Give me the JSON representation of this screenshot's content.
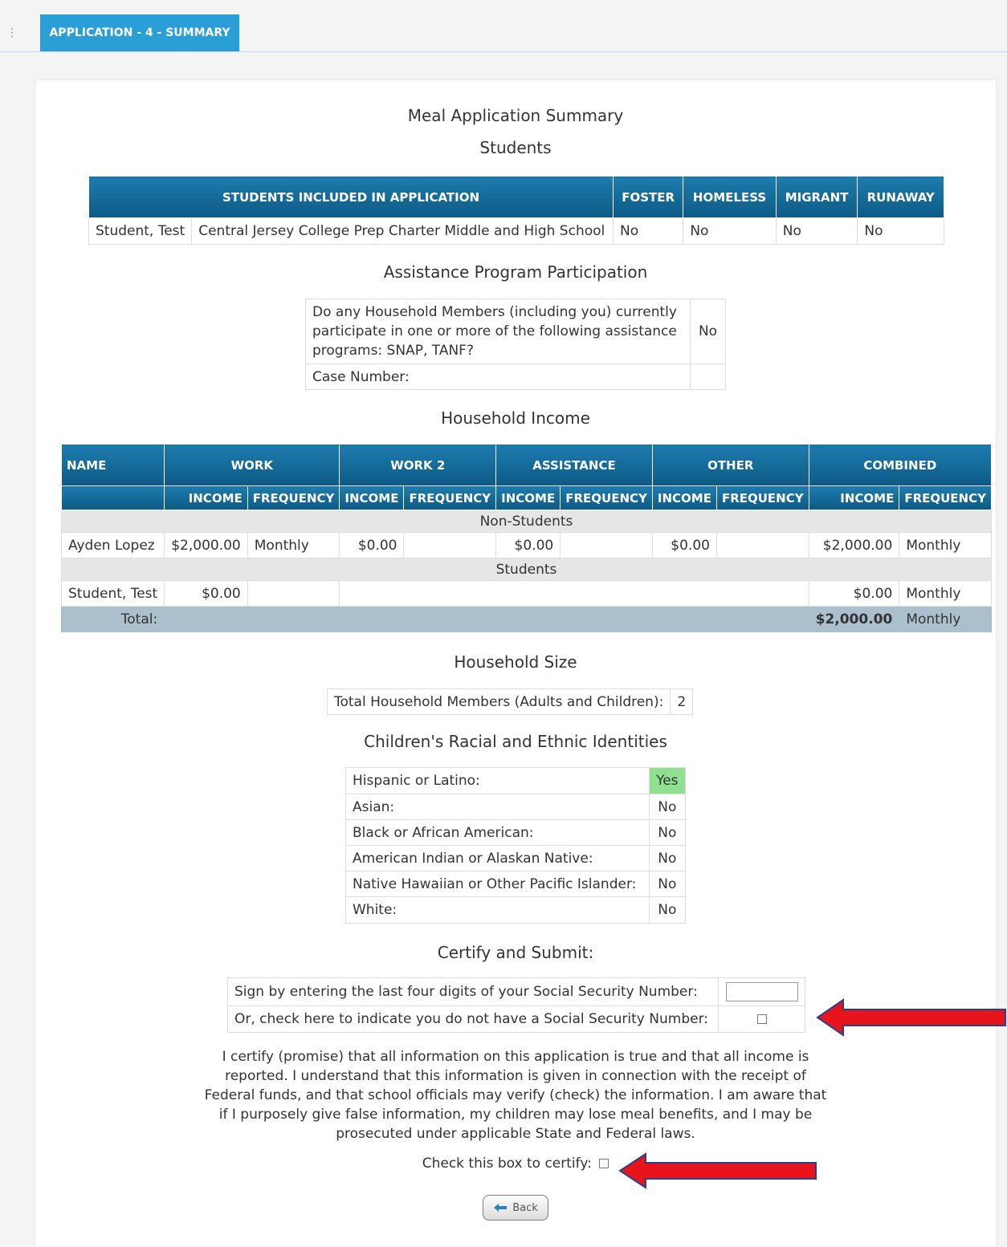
{
  "tab": {
    "label": "APPLICATION - 4 - SUMMARY"
  },
  "titles": {
    "main": "Meal Application Summary",
    "students": "Students",
    "assistance": "Assistance Program Participation",
    "income": "Household Income",
    "size": "Household Size",
    "racial": "Children's Racial and Ethnic Identities",
    "certify": "Certify and Submit:"
  },
  "students_table": {
    "headers": [
      "STUDENTS INCLUDED IN APPLICATION",
      "FOSTER",
      "HOMELESS",
      "MIGRANT",
      "RUNAWAY"
    ],
    "rows": [
      {
        "name": "Student, Test",
        "school": "Central Jersey College Prep Charter Middle and High School",
        "foster": "No",
        "homeless": "No",
        "migrant": "No",
        "runaway": "No"
      }
    ]
  },
  "assistance": {
    "question": "Do any Household Members (including you) currently participate in one or more of the following assistance programs: SNAP, TANF?",
    "answer": "No",
    "case_label": "Case Number:",
    "case_value": ""
  },
  "income": {
    "group_headers": [
      "NAME",
      "WORK",
      "WORK 2",
      "ASSISTANCE",
      "OTHER",
      "COMBINED"
    ],
    "sub_income": "INCOME",
    "sub_frequency": "FREQUENCY",
    "non_students_label": "Non-Students",
    "students_label": "Students",
    "non_student_row": {
      "name": "Ayden Lopez",
      "work_income": "$2,000.00",
      "work_freq": "Monthly",
      "work2_income": "$0.00",
      "assist_income": "$0.00",
      "other_income": "$0.00",
      "combined_income": "$2,000.00",
      "combined_freq": "Monthly"
    },
    "student_row": {
      "name": "Student, Test",
      "work_income": "$0.00",
      "combined_income": "$0.00",
      "combined_freq": "Monthly"
    },
    "total": {
      "label": "Total:",
      "combined_income": "$2,000.00",
      "combined_freq": "Monthly"
    }
  },
  "household_size": {
    "label": "Total Household Members (Adults and Children):",
    "value": "2"
  },
  "racial": [
    {
      "label": "Hispanic or Latino:",
      "value": "Yes"
    },
    {
      "label": "Asian:",
      "value": "No"
    },
    {
      "label": "Black or African American:",
      "value": "No"
    },
    {
      "label": "American Indian or Alaskan Native:",
      "value": "No"
    },
    {
      "label": "Native Hawaiian or Other Pacific Islander:",
      "value": "No"
    },
    {
      "label": "White:",
      "value": "No"
    }
  ],
  "certify": {
    "ssn_label": "Sign by entering the last four digits of your Social Security Number:",
    "no_ssn_label": "Or, check here to indicate you do not have a Social Security Number:",
    "statement": "I certify (promise) that all information on this application is true and that all income is reported. I understand that this information is given in connection with the receipt of Federal funds, and that school officials may verify (check) the information. I am aware that if I purposely give false information, my children may lose meal benefits, and I may be prosecuted under applicable State and Federal laws.",
    "certify_checkbox_label": "Check this box to certify:",
    "back_label": "Back"
  },
  "colors": {
    "tab": "#2a9fd6",
    "header": "#0d5a85",
    "yes_highlight": "#8fe08f",
    "total_row": "#abbfcc",
    "arrow": "#e8141b"
  }
}
